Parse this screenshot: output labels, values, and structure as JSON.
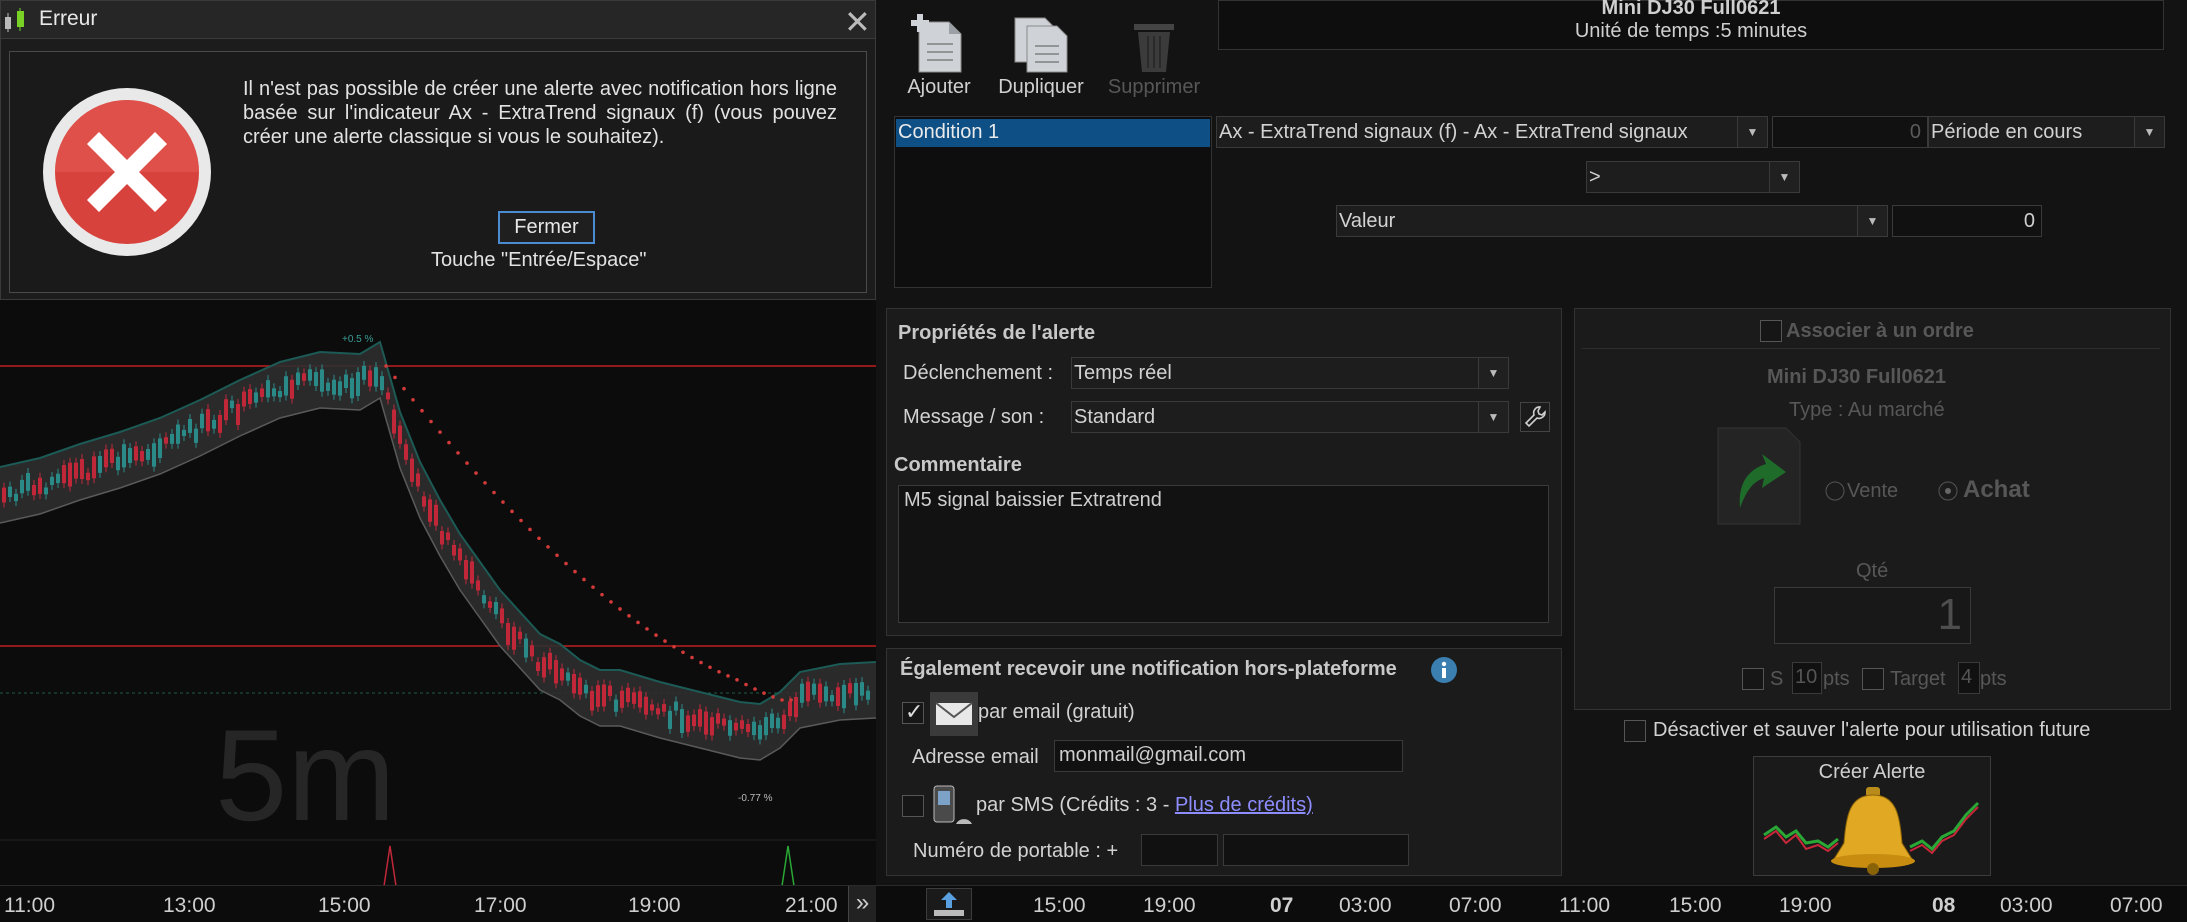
{
  "dialog": {
    "title": "Erreur",
    "close_glyph": "✕",
    "message": "Il n'est pas possible de créer une alerte avec notification hors ligne basée sur l'indicateur Ax - ExtraTrend signaux (f) (vous pouvez créer une alerte classique si vous le souhaitez).",
    "button_label": "Fermer",
    "hint": "Touche \"Entrée/Espace\"",
    "icon": "error-x-icon"
  },
  "chart": {
    "watermark": "5m",
    "high_label": "+0.5 %",
    "low_label": "-0.77 %",
    "colors": {
      "up": "#2a8a88",
      "down": "#c0283a",
      "band": "#2e2e2e",
      "band_top": "#1c5a55",
      "trail": "#d33a3a",
      "hline": "#c01e1e"
    }
  },
  "time_axis": {
    "left_ticks": [
      "11:00",
      "13:00",
      "15:00",
      "17:00",
      "19:00",
      "21:00"
    ],
    "right_ticks": [
      "15:00",
      "19:00",
      "07",
      "03:00",
      "07:00",
      "11:00",
      "15:00",
      "19:00",
      "08",
      "03:00",
      "07:00"
    ],
    "scroll_glyph": "»"
  },
  "header": {
    "instrument": "Mini DJ30 Full0621",
    "timeframe": "Unité de temps :5 minutes"
  },
  "toolbar": {
    "add": "Ajouter",
    "duplicate": "Dupliquer",
    "delete": "Supprimer"
  },
  "conditions": {
    "items": [
      "Condition 1"
    ],
    "indicator": "Ax - ExtraTrend signaux (f) - Ax - ExtraTrend signaux",
    "offset": "0",
    "period": "Période en cours",
    "operator": ">",
    "compare": "Valeur",
    "compare_value": "0"
  },
  "properties": {
    "title": "Propriétés de l'alerte",
    "trigger_label": "Déclenchement :",
    "trigger_value": "Temps réel",
    "message_label": "Message / son :",
    "message_value": "Standard",
    "comment_title": "Commentaire",
    "comment_text": "M5 signal baissier Extratrend"
  },
  "notify": {
    "title": "Également recevoir une notification hors-plateforme",
    "email_label": "par email (gratuit)",
    "email_checked": true,
    "address_label": "Adresse email",
    "address_value": "monmail@gmail.com",
    "sms_label": "par SMS (Crédits : 3 - ",
    "sms_link": "Plus de crédits)",
    "phone_label": "Numéro de portable : +"
  },
  "order": {
    "associate_label": "Associer à un ordre",
    "instrument": "Mini DJ30 Full0621",
    "type": "Type : Au marché",
    "sell": "Vente",
    "buy": "Achat",
    "qty_label": "Qté",
    "qty_value": "1",
    "stop_label": "S",
    "stop_value": "10",
    "pts1": "pts",
    "target_label": "Target",
    "target_value": "4",
    "pts2": "pts"
  },
  "footer": {
    "disable_label": "Désactiver et sauver l'alerte pour utilisation future",
    "create_label": "Créer Alerte"
  }
}
